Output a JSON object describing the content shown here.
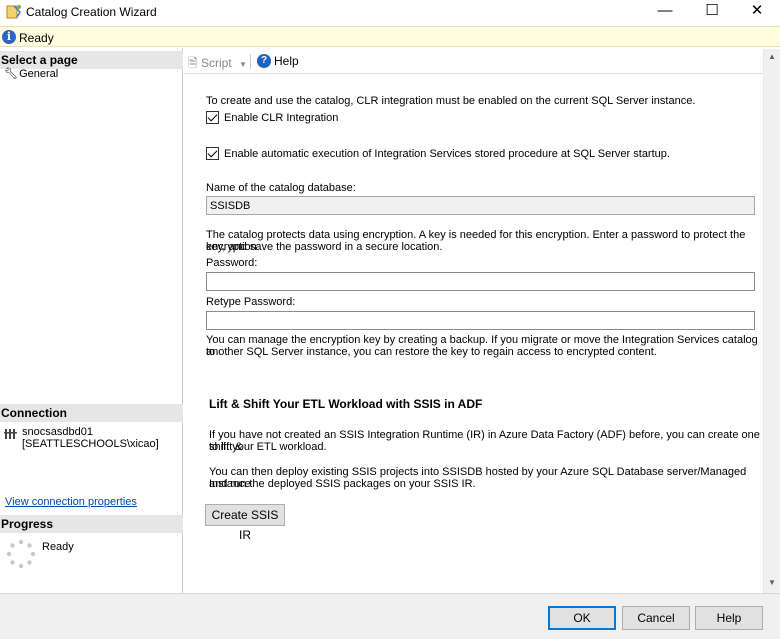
{
  "window": {
    "title": "Catalog Creation Wizard",
    "minimize_glyph": "—",
    "maximize_glyph": "☐",
    "close_glyph": "✕"
  },
  "status": {
    "text": "Ready"
  },
  "left": {
    "select_page_header": "Select a page",
    "pages": [
      {
        "label": "General",
        "icon": "wrench-icon"
      }
    ],
    "connection_header": "Connection",
    "connection_server": "snocsasdbd01",
    "connection_user": "[SEATTLESCHOOLS\\xicao]",
    "connection_link": "View connection properties",
    "progress_header": "Progress",
    "progress_status": "Ready"
  },
  "toolbar": {
    "script_label": "Script",
    "help_label": "Help"
  },
  "form": {
    "clr_intro": "To create and use the catalog, CLR integration must be enabled on the current SQL Server instance.",
    "enable_clr_label": "Enable CLR Integration",
    "enable_clr_checked": true,
    "auto_exec_label": "Enable automatic execution of Integration Services stored procedure at SQL Server startup.",
    "auto_exec_checked": true,
    "catalog_db_label": "Name of the catalog database:",
    "catalog_db_value": "SSISDB",
    "encryption_line1": "The catalog protects data using encryption. A key is needed for this encryption. Enter a password to protect the encryption",
    "encryption_line2": "key, and save the password in a secure location.",
    "password_label": "Password:",
    "password_value": "",
    "retype_label": "Retype Password:",
    "retype_value": "",
    "backup_line1": "You can manage the encryption key by creating a backup. If you migrate or move the Integration Services catalog to",
    "backup_line2": "another SQL Server instance, you can restore the key to regain access to encrypted content."
  },
  "adf": {
    "heading": "Lift & Shift Your ETL Workload with SSIS in ADF",
    "para1_line1": "If you have not created an SSIS Integration Runtime (IR) in Azure Data Factory (ADF) before, you can create one to lift &",
    "para1_line2": "shift your ETL workload.",
    "para2_line1": "You can then deploy existing SSIS projects into SSISDB hosted by your Azure SQL Database server/Managed Instance",
    "para2_line2": "and run the deployed SSIS packages on your SSIS IR.",
    "create_button": "Create SSIS IR"
  },
  "buttons": {
    "ok": "OK",
    "cancel": "Cancel",
    "help": "Help"
  },
  "colors": {
    "accent": "#0078d7",
    "status_bar": "#fefde0",
    "link": "#0645ad"
  }
}
